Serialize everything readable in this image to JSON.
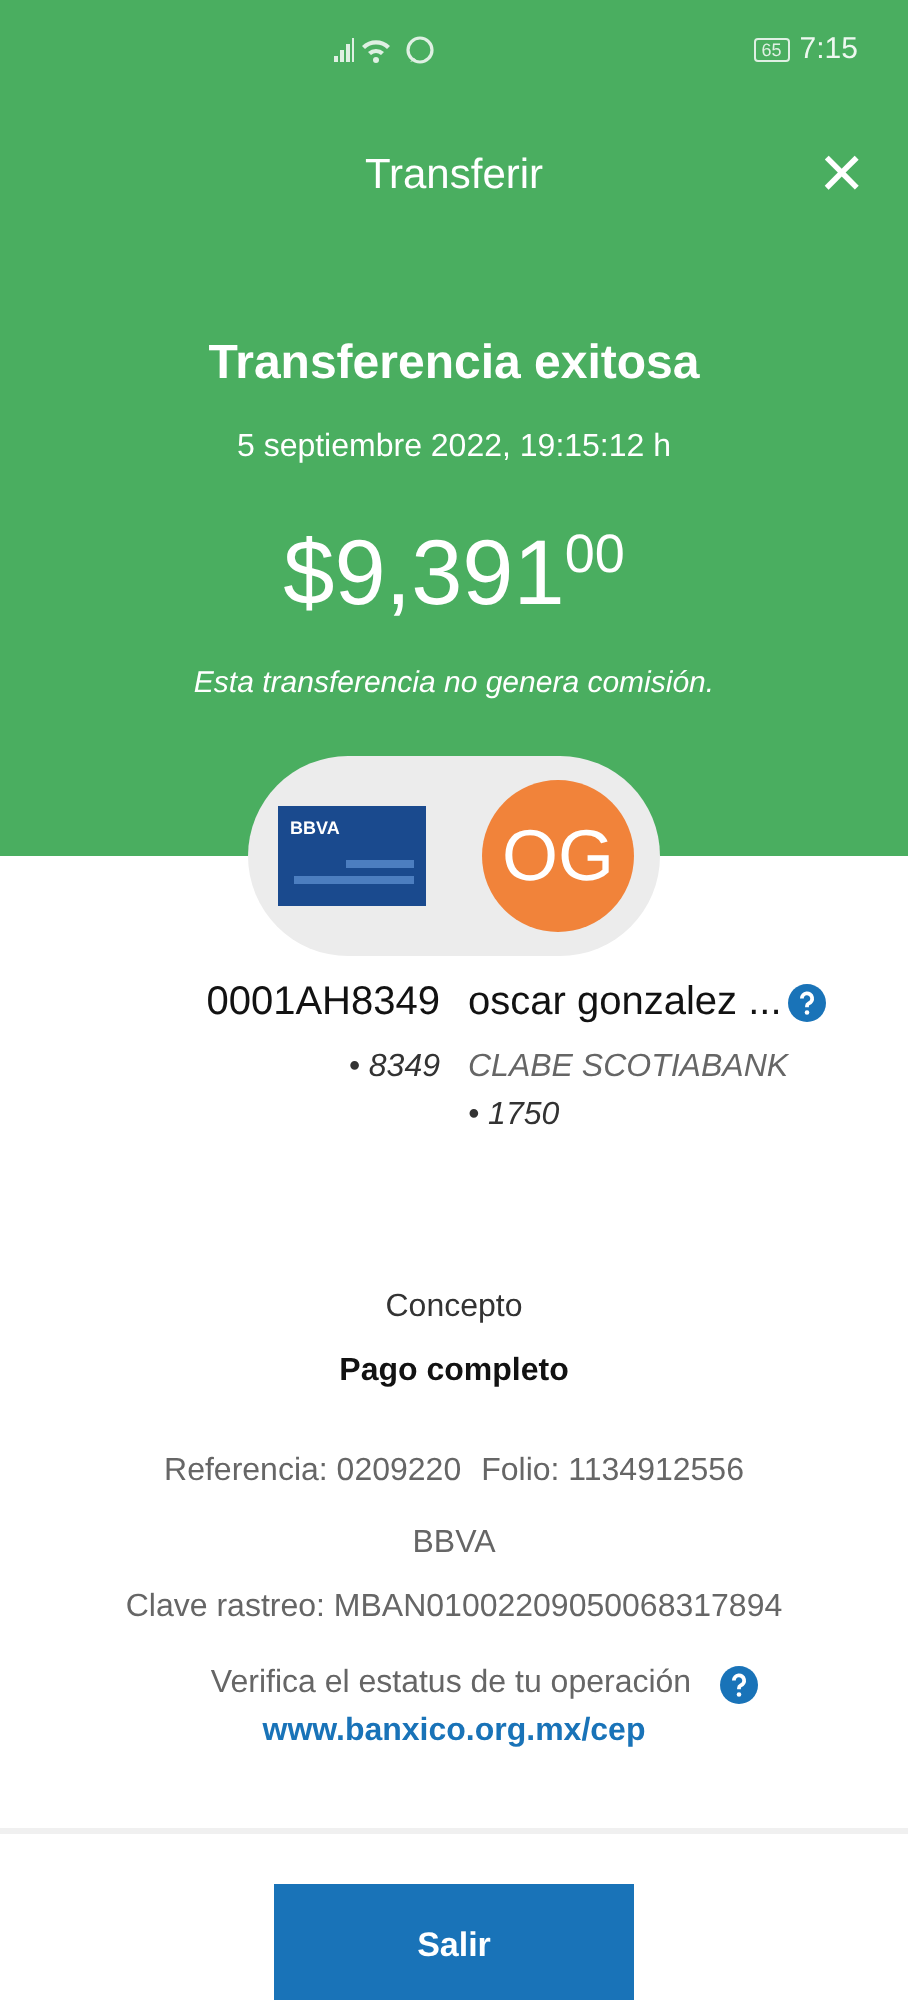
{
  "status_bar": {
    "battery": "65",
    "time": "7:15"
  },
  "header": {
    "title": "Transferir",
    "close": "×"
  },
  "result": {
    "title": "Transferencia exitosa",
    "date": "5 septiembre 2022, 19:15:12 h",
    "amount": "$9,391$^{00}$",
    "note": "Esta transferencia no genera comisión."
  },
  "from": {
    "bank_logo": "BBVA",
    "account": "0001AH8349",
    "digits": "• 8349"
  },
  "to": {
    "initials": "OG",
    "name": "oscar gonzalez ...",
    "bank": "CLABE SCOTIABANK",
    "digits": "• 1750"
  },
  "concept": {
    "label": "Concepto",
    "value": "Pago completo"
  },
  "details": {
    "reference": "Referencia: 0209220",
    "folio": "Folio: 1134912556",
    "bank": "BBVA",
    "tracking": "Clave rastreo: MBAN01002209050068317894"
  },
  "verify": {
    "text": "Verifica el estatus de tu operación",
    "link": "www.banxico.org.mx/cep"
  },
  "button": "Salir"
}
